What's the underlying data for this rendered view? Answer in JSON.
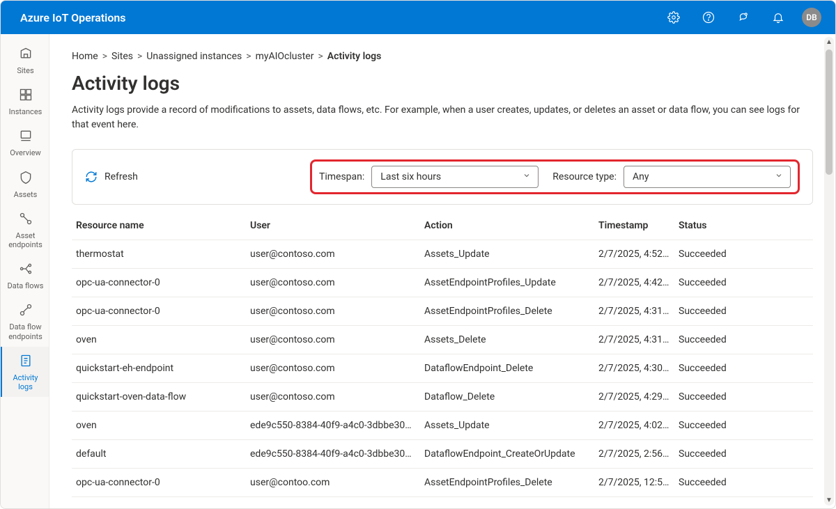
{
  "app": {
    "title": "Azure IoT Operations",
    "avatar_initials": "DB"
  },
  "sidebar": {
    "items": [
      {
        "label": "Sites",
        "icon": "sites"
      },
      {
        "label": "Instances",
        "icon": "instances"
      },
      {
        "label": "Overview",
        "icon": "overview"
      },
      {
        "label": "Assets",
        "icon": "assets"
      },
      {
        "label": "Asset endpoints",
        "icon": "asset-endpoints"
      },
      {
        "label": "Data flows",
        "icon": "dataflows"
      },
      {
        "label": "Data flow endpoints",
        "icon": "dataflow-endpoints"
      },
      {
        "label": "Activity logs",
        "icon": "activity-logs",
        "active": true
      }
    ]
  },
  "breadcrumb": {
    "items": [
      "Home",
      "Sites",
      "Unassigned instances",
      "myAIOcluster"
    ],
    "current": "Activity logs"
  },
  "page": {
    "title": "Activity logs",
    "description": "Activity logs provide a record of modifications to assets, data flows, etc. For example, when a user creates, updates, or deletes an asset or data flow, you can see logs for that event here."
  },
  "filter": {
    "refresh_label": "Refresh",
    "timespan_label": "Timespan:",
    "timespan_value": "Last six hours",
    "resource_type_label": "Resource type:",
    "resource_type_value": "Any"
  },
  "table": {
    "headers": {
      "resource_name": "Resource name",
      "user": "User",
      "action": "Action",
      "timestamp": "Timestamp",
      "status": "Status"
    },
    "rows": [
      {
        "resource_name": "thermostat",
        "user": "user@contoso.com",
        "action": "Assets_Update",
        "timestamp": "2/7/2025, 4:52:…",
        "status": "Succeeded"
      },
      {
        "resource_name": "opc-ua-connector-0",
        "user": "user@contoso.com",
        "action": "AssetEndpointProfiles_Update",
        "timestamp": "2/7/2025, 4:42:…",
        "status": "Succeeded"
      },
      {
        "resource_name": "opc-ua-connector-0",
        "user": "user@contoso.com",
        "action": "AssetEndpointProfiles_Delete",
        "timestamp": "2/7/2025, 4:31:…",
        "status": "Succeeded"
      },
      {
        "resource_name": "oven",
        "user": "user@contoso.com",
        "action": "Assets_Delete",
        "timestamp": "2/7/2025, 4:31:…",
        "status": "Succeeded"
      },
      {
        "resource_name": "quickstart-eh-endpoint",
        "user": "user@contoso.com",
        "action": "DataflowEndpoint_Delete",
        "timestamp": "2/7/2025, 4:30:…",
        "status": "Succeeded"
      },
      {
        "resource_name": "quickstart-oven-data-flow",
        "user": "user@contoso.com",
        "action": "Dataflow_Delete",
        "timestamp": "2/7/2025, 4:29:…",
        "status": "Succeeded"
      },
      {
        "resource_name": "oven",
        "user": "ede9c550-8384-40f9-a4c0-3dbbe30…",
        "action": "Assets_Update",
        "timestamp": "2/7/2025, 4:02:…",
        "status": "Succeeded"
      },
      {
        "resource_name": "default",
        "user": "ede9c550-8384-40f9-a4c0-3dbbe30…",
        "action": "DataflowEndpoint_CreateOrUpdate",
        "timestamp": "2/7/2025, 2:56:…",
        "status": "Succeeded"
      },
      {
        "resource_name": "opc-ua-connector-0",
        "user": "user@contoo.com",
        "action": "AssetEndpointProfiles_Delete",
        "timestamp": "2/7/2025, 12:5…",
        "status": "Succeeded"
      }
    ]
  }
}
